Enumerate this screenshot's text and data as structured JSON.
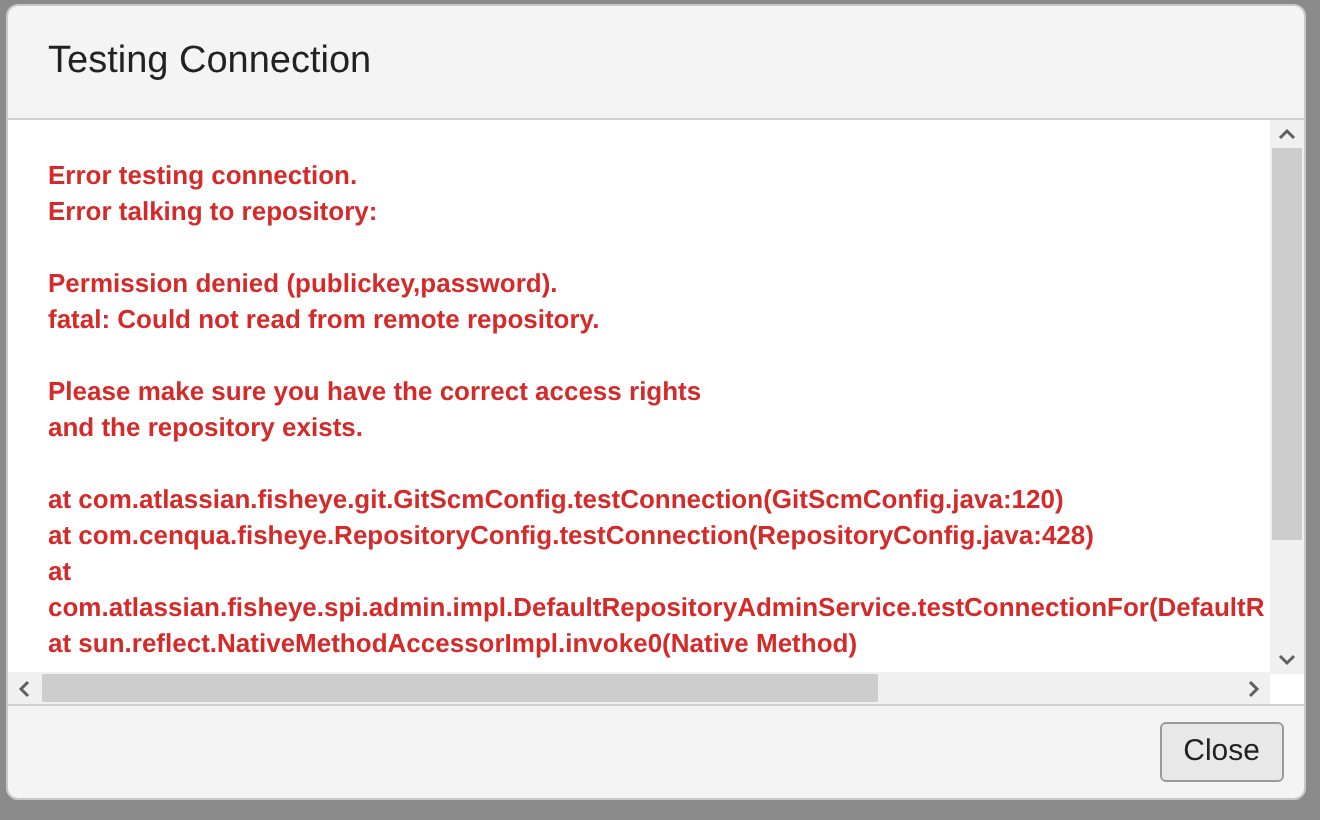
{
  "dialog": {
    "title": "Testing Connection",
    "paragraphs": [
      [
        "Error testing connection.",
        "Error talking to repository:"
      ],
      [
        "Permission denied (publickey,password).",
        "fatal: Could not read from remote repository."
      ],
      [
        "Please make sure you have the correct access rights",
        "and the repository exists."
      ],
      [
        "at com.atlassian.fisheye.git.GitScmConfig.testConnection(GitScmConfig.java:120)",
        "at com.cenqua.fisheye.RepositoryConfig.testConnection(RepositoryConfig.java:428)",
        "at",
        "com.atlassian.fisheye.spi.admin.impl.DefaultRepositoryAdminService.testConnectionFor(DefaultR",
        "at sun.reflect.NativeMethodAccessorImpl.invoke0(Native Method)"
      ]
    ],
    "buttons": [
      "Close"
    ]
  }
}
